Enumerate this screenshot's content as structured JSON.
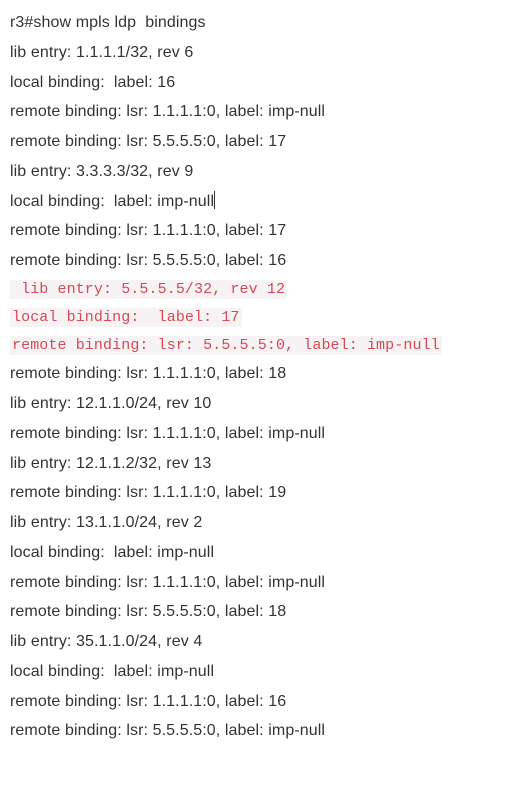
{
  "lines": [
    {
      "text": "r3#show mpls ldp  bindings",
      "style": "normal"
    },
    {
      "text": "lib entry: 1.1.1.1/32, rev 6",
      "style": "normal"
    },
    {
      "text": "local binding:  label: 16",
      "style": "normal"
    },
    {
      "text": "remote binding: lsr: 1.1.1.1:0, label: imp-null",
      "style": "normal"
    },
    {
      "text": "remote binding: lsr: 5.5.5.5:0, label: 17",
      "style": "normal"
    },
    {
      "text": "lib entry: 3.3.3.3/32, rev 9",
      "style": "normal"
    },
    {
      "text": "local binding:  label: imp-null",
      "style": "normal",
      "caret": true
    },
    {
      "text": "remote binding: lsr: 1.1.1.1:0, label: 17",
      "style": "normal"
    },
    {
      "text": "remote binding: lsr: 5.5.5.5:0, label: 16",
      "style": "normal"
    },
    {
      "text": " lib entry: 5.5.5.5/32, rev 12",
      "style": "hl",
      "bg": true
    },
    {
      "text": "local binding:  label: 17",
      "style": "hl",
      "bg": true
    },
    {
      "text": "remote binding: lsr: 5.5.5.5:0, label: imp-null",
      "style": "hl",
      "bg": true
    },
    {
      "text": "remote binding: lsr: 1.1.1.1:0, label: 18",
      "style": "normal"
    },
    {
      "text": "lib entry: 12.1.1.0/24, rev 10",
      "style": "normal"
    },
    {
      "text": "remote binding: lsr: 1.1.1.1:0, label: imp-null",
      "style": "normal"
    },
    {
      "text": "lib entry: 12.1.1.2/32, rev 13",
      "style": "normal"
    },
    {
      "text": "remote binding: lsr: 1.1.1.1:0, label: 19",
      "style": "normal"
    },
    {
      "text": "lib entry: 13.1.1.0/24, rev 2",
      "style": "normal"
    },
    {
      "text": "local binding:  label: imp-null",
      "style": "normal"
    },
    {
      "text": "remote binding: lsr: 1.1.1.1:0, label: imp-null",
      "style": "normal"
    },
    {
      "text": "remote binding: lsr: 5.5.5.5:0, label: 18",
      "style": "normal"
    },
    {
      "text": "lib entry: 35.1.1.0/24, rev 4",
      "style": "normal"
    },
    {
      "text": "local binding:  label: imp-null",
      "style": "normal"
    },
    {
      "text": "remote binding: lsr: 1.1.1.1:0, label: 16",
      "style": "normal"
    },
    {
      "text": "remote binding: lsr: 5.5.5.5:0, label: imp-null",
      "style": "normal"
    }
  ]
}
